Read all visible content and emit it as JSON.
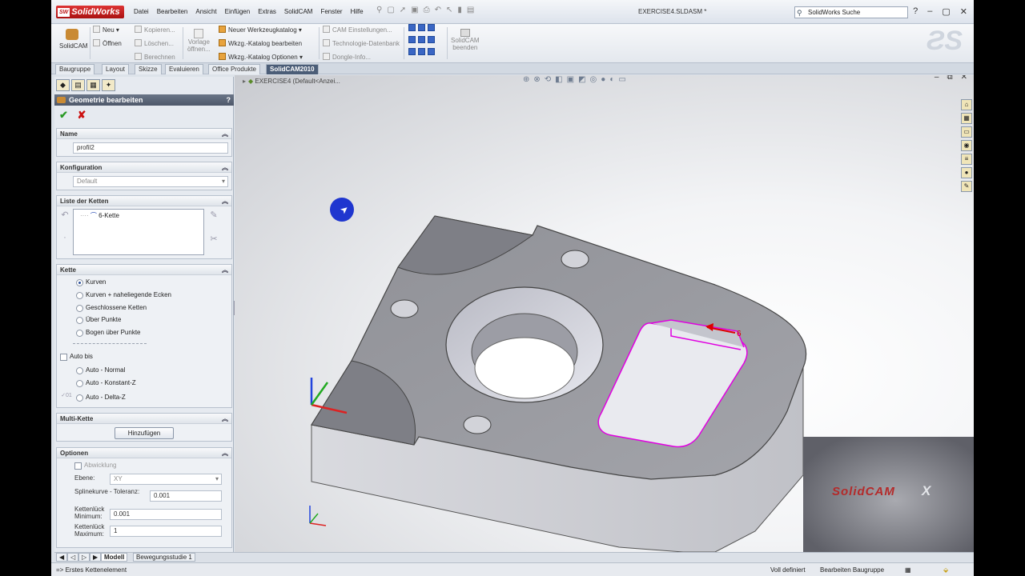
{
  "titlebar": {
    "app_name": "SolidWorks",
    "menu": [
      "Datei",
      "Bearbeiten",
      "Ansicht",
      "Einfügen",
      "Extras",
      "SolidCAM",
      "Fenster",
      "Hilfe"
    ],
    "document_title": "EXERCISE4.SLDASM *",
    "search_placeholder": "SolidWorks Suche"
  },
  "ribbon": {
    "solidcam": "SolidCAM",
    "neu": "Neu",
    "oeffnen": "Öffnen",
    "kopieren": "Kopieren...",
    "loeschen": "Löschen...",
    "berechnen": "Berechnen",
    "vorlage_1": "Vorlage",
    "vorlage_2": "öffnen...",
    "neuer_werkzeugkatalog": "Neuer Werkzeugkatalog",
    "wkzg_katalog_bearbeiten": "Wkzg.-Katalog bearbeiten",
    "wkzg_katalog_optionen": "Wkzg.-Katalog Optionen",
    "cam_einstellungen": "CAM Einstellungen...",
    "technologie_datenbank": "Technologie-Datenbank",
    "dongle_info": "Dongle-Info...",
    "solidcam_beenden_1": "SolidCAM",
    "solidcam_beenden_2": "beenden"
  },
  "tabs": [
    "Baugruppe",
    "Layout",
    "Skizze",
    "Evaluieren",
    "Office Produkte",
    "SolidCAM2010"
  ],
  "panel": {
    "title": "Geometrie bearbeiten",
    "help": "?",
    "name_section": "Name",
    "name_value": "profil2",
    "konfig_section": "Konfiguration",
    "konfig_value": "Default",
    "ketten_section": "Liste der Ketten",
    "kette_item": "6-Kette",
    "kette_section": "Kette",
    "kette_options": [
      "Kurven",
      "Kurven + naheliegende Ecken",
      "Geschlossene Ketten",
      "Über Punkte",
      "Bogen über Punkte"
    ],
    "auto_bis": "Auto bis",
    "auto_options": [
      "Auto - Normal",
      "Auto - Konstant-Z",
      "Auto - Delta-Z"
    ],
    "multi_section": "Multi-Kette",
    "hinzufuegen": "Hinzufügen",
    "optionen_section": "Optionen",
    "abwicklung": "Abwicklung",
    "ebene_label": "Ebene:",
    "ebene_value": "XY",
    "spline_label": "Splinekurve - Toleranz:",
    "spline_value": "0.001",
    "min_label_1": "Kettenlück",
    "min_label_2": "Minimum:",
    "min_value": "0.001",
    "max_label_1": "Kettenlück",
    "max_label_2": "Maximum:",
    "max_value": "1"
  },
  "viewport": {
    "tree_title": "EXERCISE4  (Default<Anzei...",
    "chain_label": "6",
    "video_logo_1": "SolidCAM",
    "video_logo_2": "X"
  },
  "bottom_tabs": [
    "Modell",
    "Bewegungsstudie 1"
  ],
  "status": {
    "left": "=> Erstes Kettenelement",
    "state": "Voll definiert",
    "mode": "Bearbeiten Baugruppe"
  },
  "colors": {
    "accent": "#4b5d77",
    "chain": "#e000e0",
    "ok": "#2b9a26",
    "cancel": "#cc1111"
  }
}
